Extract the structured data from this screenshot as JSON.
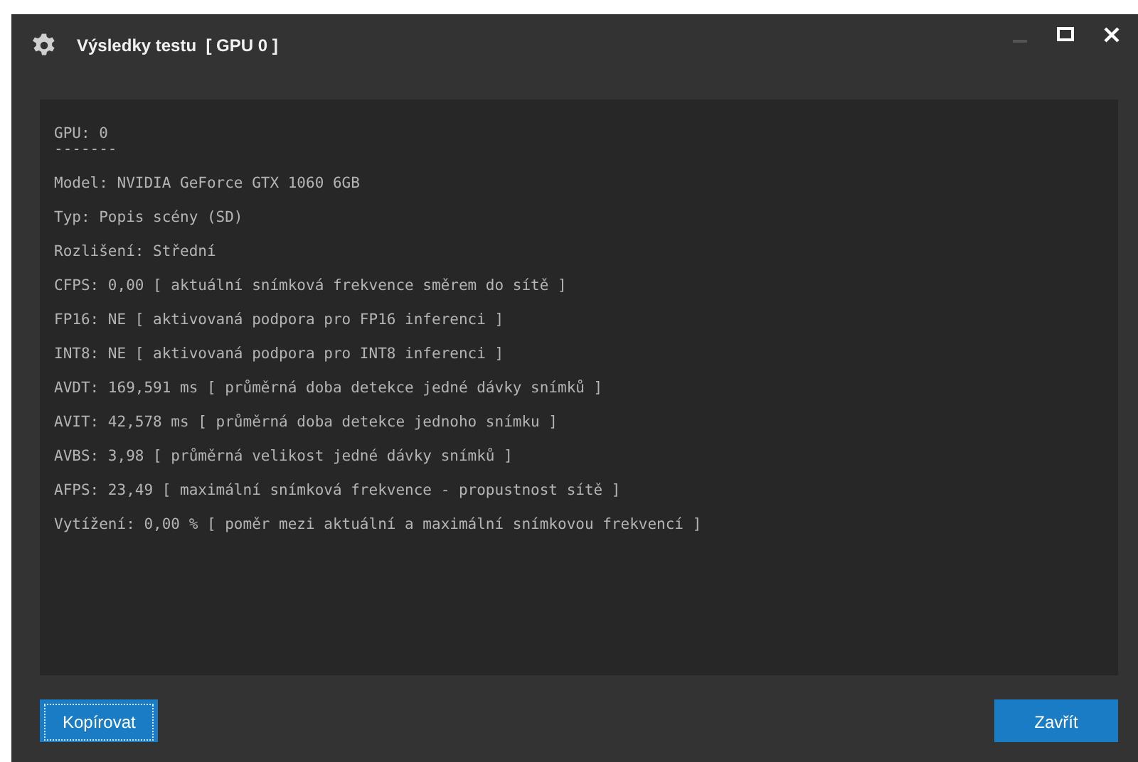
{
  "window": {
    "title": "Výsledky testu  [ GPU 0 ]"
  },
  "report": {
    "heading": "GPU: 0",
    "separator": "-------",
    "lines": [
      "Model: NVIDIA GeForce GTX 1060 6GB",
      "Typ: Popis scény (SD)",
      "Rozlišení: Střední",
      "CFPS: 0,00 [ aktuální snímková frekvence směrem do sítě ]",
      "FP16: NE [ aktivovaná podpora pro FP16 inferenci ]",
      "INT8: NE [ aktivovaná podpora pro INT8 inferenci ]",
      "AVDT: 169,591 ms [ průměrná doba detekce jedné dávky snímků ]",
      "AVIT: 42,578 ms [ průměrná doba detekce jednoho snímku ]",
      "AVBS: 3,98 [ průměrná velikost jedné dávky snímků ]",
      "AFPS: 23,49 [ maximální snímková frekvence - propustnost sítě ]",
      "Vytížení: 0,00 % [ poměr mezi aktuální a maximální snímkovou frekvencí ]"
    ]
  },
  "buttons": [
    {
      "label": "Kopírovat",
      "focused": true
    },
    {
      "label": "Zavřít",
      "focused": false
    }
  ]
}
